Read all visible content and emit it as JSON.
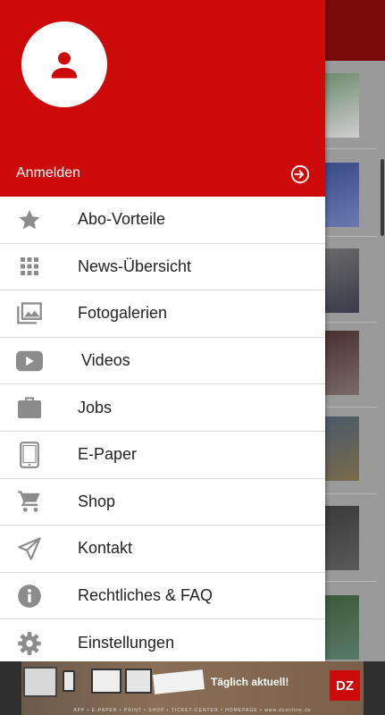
{
  "drawer": {
    "login_label": "Anmelden",
    "login_icon": "login-icon",
    "avatar_icon": "person-icon",
    "menu": [
      {
        "label": "Abo-Vorteile",
        "icon": "star-icon"
      },
      {
        "label": "News-Übersicht",
        "icon": "grid-icon"
      },
      {
        "label": "Fotogalerien",
        "icon": "photo-gallery-icon"
      },
      {
        "label": "Videos",
        "icon": "youtube-icon"
      },
      {
        "label": "Jobs",
        "icon": "briefcase-icon"
      },
      {
        "label": "E-Paper",
        "icon": "tablet-icon"
      },
      {
        "label": "Shop",
        "icon": "cart-icon"
      },
      {
        "label": "Kontakt",
        "icon": "send-icon"
      },
      {
        "label": "Rechtliches & FAQ",
        "icon": "info-icon"
      },
      {
        "label": "Einstellungen",
        "icon": "gear-icon"
      }
    ]
  },
  "banner": {
    "tagline": "Täglich aktuell!",
    "logo_text": "DZ",
    "links": "APP • E-PAPER • PRINT • SHOP • TICKET-CENTER • HOMEPAGE • www.dzonline.de"
  },
  "colors": {
    "brand_red": "#cc0a0a",
    "icon_gray": "#8c8c8c",
    "text": "#222222"
  }
}
